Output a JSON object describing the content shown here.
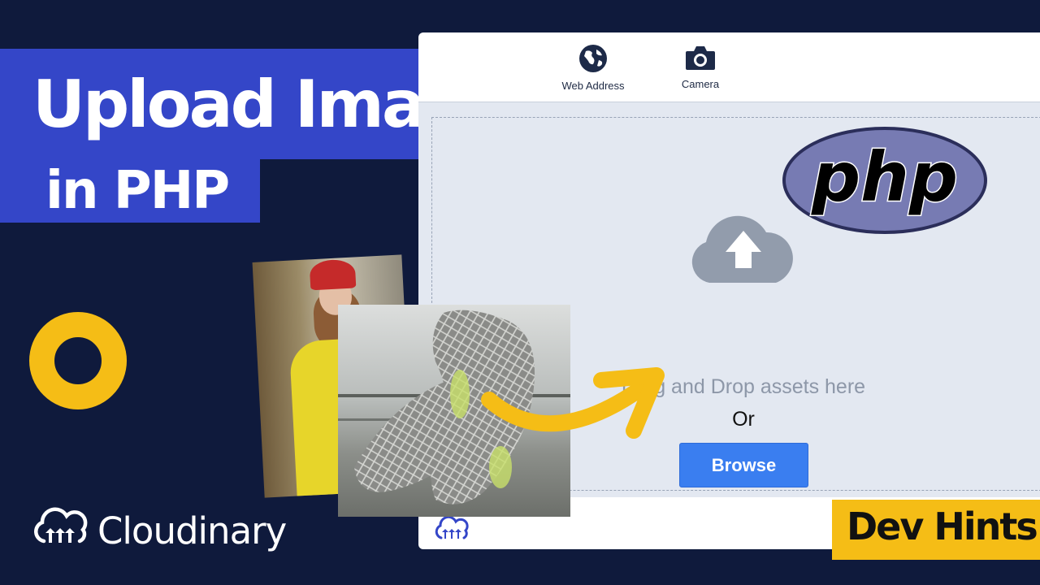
{
  "title": {
    "line1": "Upload Images",
    "line2": "in PHP"
  },
  "brand": {
    "name": "Cloudinary",
    "icon": "cloudinary-logo-icon"
  },
  "widget": {
    "tabs": [
      {
        "label": "Web Address",
        "icon": "globe-icon"
      },
      {
        "label": "Camera",
        "icon": "camera-icon"
      }
    ],
    "dropzone": {
      "icon": "cloud-upload-icon",
      "text": "Drag and Drop assets here",
      "or_text": "Or",
      "browse_label": "Browse"
    }
  },
  "php_logo": {
    "text": "php",
    "icon": "php-logo"
  },
  "badge": {
    "label": "Dev Hints"
  },
  "colors": {
    "background": "#0f1a3c",
    "title_bg": "#3446c8",
    "accent_yellow": "#f5bd16",
    "browse_button": "#3a7ef0",
    "dropzone_bg": "#e3e8f1",
    "php_purple": "#777bb3"
  }
}
